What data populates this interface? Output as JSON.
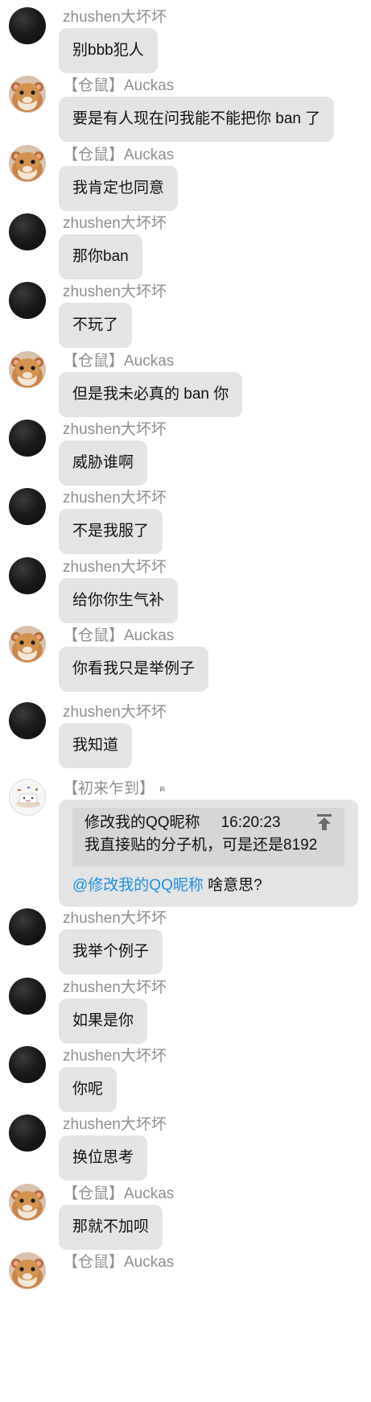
{
  "messages": [
    {
      "sender": "zhushen大坏坏",
      "avatar": "black-circle-avatar",
      "text": "别bbb犯人"
    },
    {
      "sender": "【仓鼠】Auckas",
      "avatar": "hamster-avatar",
      "text": "要是有人现在问我能不能把你 ban 了"
    },
    {
      "sender": "【仓鼠】Auckas",
      "avatar": "hamster-avatar",
      "text": "我肯定也同意"
    },
    {
      "sender": "zhushen大坏坏",
      "avatar": "black-circle-avatar",
      "text": "那你ban"
    },
    {
      "sender": "zhushen大坏坏",
      "avatar": "black-circle-avatar",
      "text": "不玩了"
    },
    {
      "sender": "【仓鼠】Auckas",
      "avatar": "hamster-avatar",
      "text": "但是我未必真的 ban 你"
    },
    {
      "sender": "zhushen大坏坏",
      "avatar": "black-circle-avatar",
      "text": "威胁谁啊"
    },
    {
      "sender": "zhushen大坏坏",
      "avatar": "black-circle-avatar",
      "text": "不是我服了"
    },
    {
      "sender": "zhushen大坏坏",
      "avatar": "black-circle-avatar",
      "text": "给你你生气补"
    },
    {
      "sender": "【仓鼠】Auckas",
      "avatar": "hamster-avatar",
      "text": "你看我只是举例子"
    },
    {
      "sender": "zhushen大坏坏",
      "avatar": "black-circle-avatar",
      "text": "我知道"
    }
  ],
  "reply_message": {
    "sender": "【初来乍到】",
    "badge": "ฅ",
    "avatar": "tofu-avatar",
    "quote_author": "修改我的QQ昵称",
    "quote_time": "16:20:23",
    "quote_text": "我直接贴的分子机，可是还是8192",
    "mention": "@修改我的QQ昵称",
    "text": " 啥意思?"
  },
  "messages_after": [
    {
      "sender": "zhushen大坏坏",
      "avatar": "black-circle-avatar",
      "text": "我举个例子"
    },
    {
      "sender": "zhushen大坏坏",
      "avatar": "black-circle-avatar",
      "text": "如果是你"
    },
    {
      "sender": "zhushen大坏坏",
      "avatar": "black-circle-avatar",
      "text": "你呢"
    },
    {
      "sender": "zhushen大坏坏",
      "avatar": "black-circle-avatar",
      "text": "换位思考"
    },
    {
      "sender": "【仓鼠】Auckas",
      "avatar": "hamster-avatar",
      "text": "那就不加呗"
    },
    {
      "sender": "【仓鼠】Auckas",
      "avatar": "hamster-avatar",
      "text": ""
    }
  ],
  "colors": {
    "bubble": "#e4e4e4",
    "quote": "#d6d6d6",
    "mention": "#1e8fe0",
    "sender": "#8f8f8f"
  }
}
